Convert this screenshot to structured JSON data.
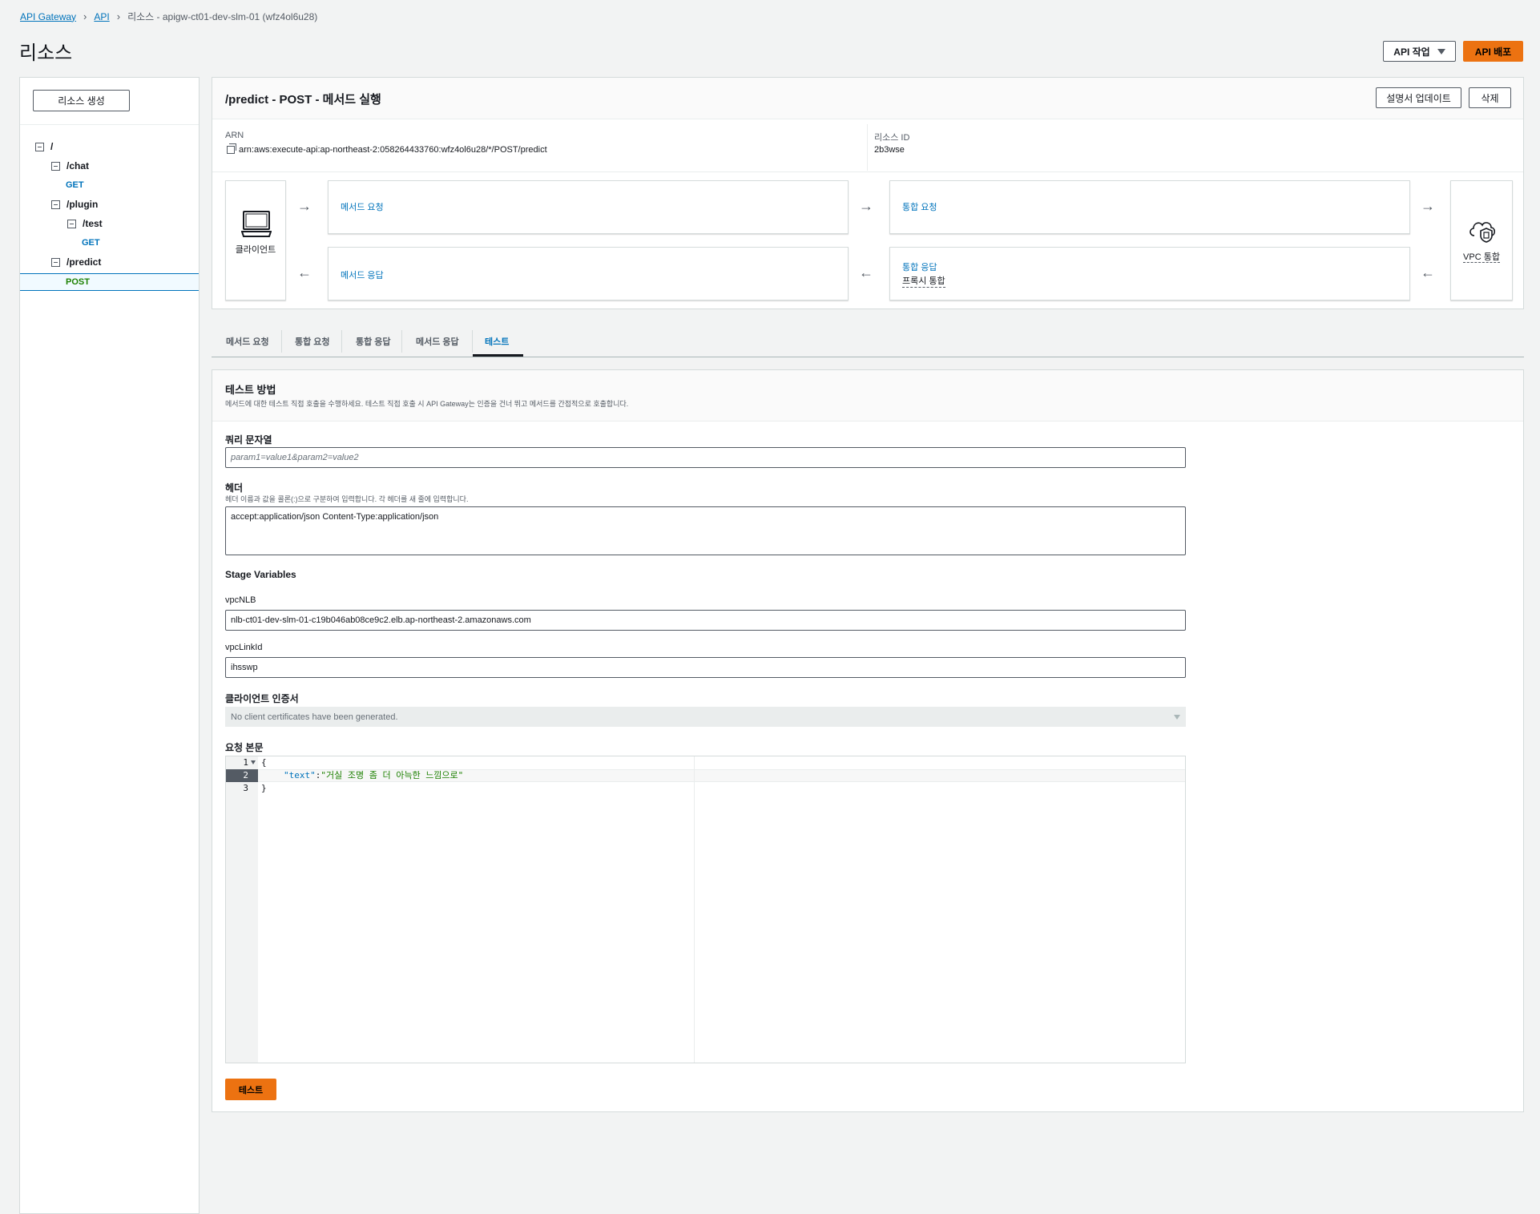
{
  "breadcrumb": {
    "items": [
      "API Gateway",
      "API"
    ],
    "current": "리소스 - apigw-ct01-dev-slm-01 (wfz4ol6u28)"
  },
  "page": {
    "title": "리소스",
    "actions_label": "API 작업",
    "deploy_label": "API 배포"
  },
  "sidebar": {
    "create_label": "리소스 생성",
    "tree": {
      "root": "/",
      "chat": "/chat",
      "chat_method": "GET",
      "plugin": "/plugin",
      "test": "/test",
      "test_method": "GET",
      "predict": "/predict",
      "predict_method": "POST"
    }
  },
  "method_panel": {
    "title": "/predict - POST - 메서드 실행",
    "update_doc_label": "설명서 업데이트",
    "delete_label": "삭제",
    "arn_label": "ARN",
    "arn_value": "arn:aws:execute-api:ap-northeast-2:058264433760:wfz4ol6u28/*/POST/predict",
    "resource_id_label": "리소스 ID",
    "resource_id_value": "2b3wse"
  },
  "flow": {
    "client_label": "클라이언트",
    "method_request": "메서드 요청",
    "integration_request": "통합 요청",
    "method_response": "메서드 응답",
    "integration_response": "통합 응답",
    "proxy_integration": "프록시 통합",
    "vpc_label": "VPC 통합"
  },
  "tabs": [
    "메서드 요청",
    "통합 요청",
    "통합 응답",
    "메서드 응답",
    "테스트"
  ],
  "active_tab": "테스트",
  "test": {
    "title": "테스트 방법",
    "description": "메서드에 대한 테스트 직접 호출을 수행하세요. 테스트 직접 호출 시 API Gateway는 인증을 건너 뛰고 메서드를 간접적으로 호출합니다.",
    "query_label": "쿼리 문자열",
    "query_placeholder": "param1=value1&param2=value2",
    "headers_label": "헤더",
    "headers_hint": "헤더 이름과 값을 콜론(:)으로 구분하여 입력합니다. 각 헤더를 새 줄에 입력합니다.",
    "headers_value": "accept:application/json Content-Type:application/json",
    "stage_vars_label": "Stage Variables",
    "vpc_nlb_label": "vpcNLB",
    "vpc_nlb_value": "nlb-ct01-dev-slm-01-c19b046ab08ce9c2.elb.ap-northeast-2.amazonaws.com",
    "vpc_link_label": "vpcLinkId",
    "vpc_link_value": "ihsswp",
    "client_cert_label": "클라이언트 인증서",
    "client_cert_value": "No client certificates have been generated.",
    "body_label": "요청 본문",
    "body_lines": {
      "n1": "1",
      "n2": "2",
      "n3": "3",
      "open": "{",
      "key": "\"text\"",
      "colon": ":",
      "value": "\"거실 조명 좀 더 아늑한 느낌으로\"",
      "close": "}"
    },
    "test_button": "테스트"
  },
  "colors": {
    "primary": "#ec7211",
    "link": "#0073bb",
    "post": "#1d8102"
  }
}
